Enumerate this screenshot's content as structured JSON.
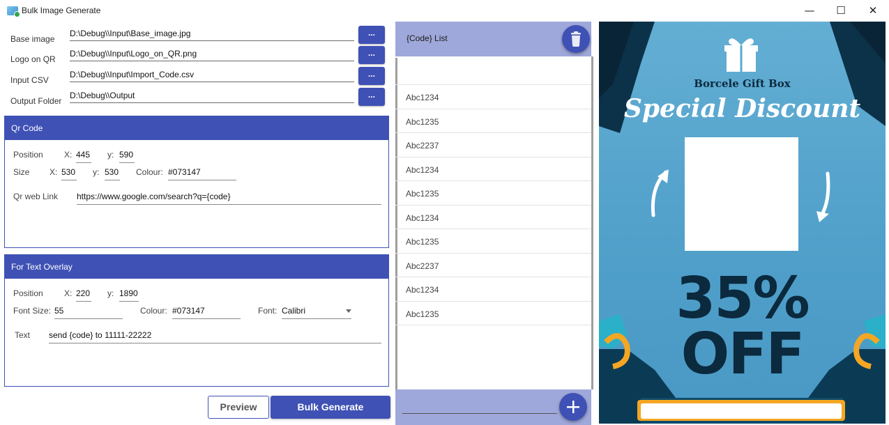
{
  "window": {
    "title": "Bulk Image Generate",
    "controls": {
      "minimize": "—",
      "maximize": "☐",
      "close": "✕"
    }
  },
  "files": [
    {
      "label": "Base image",
      "value": "D:\\Debug\\\\Input\\Base_image.jpg",
      "browse": "..."
    },
    {
      "label": "Logo on QR",
      "value": "D:\\Debug\\\\Input\\Logo_on_QR.png",
      "browse": "..."
    },
    {
      "label": "Input CSV",
      "value": "D:\\Debug\\\\Input\\Import_Code.csv",
      "browse": "..."
    },
    {
      "label": "Output Folder",
      "value": "D:\\Debug\\\\Output",
      "browse": "..."
    }
  ],
  "qr": {
    "header": "Qr Code",
    "position_label": "Position",
    "pos_x_label": "X:",
    "pos_x": "445",
    "pos_y_label": "y:",
    "pos_y": "590",
    "size_label": "Size",
    "size_x_label": "X:",
    "size_x": "530",
    "size_y_label": "y:",
    "size_y": "530",
    "colour_label": "Colour:",
    "colour": "#073147",
    "link_label": "Qr web Link",
    "link": "https://www.google.com/search?q={code}"
  },
  "overlay": {
    "header": "For Text Overlay",
    "position_label": "Position",
    "pos_x_label": "X:",
    "pos_x": "220",
    "pos_y_label": "y:",
    "pos_y": "1890",
    "font_size_label": "Font Size:",
    "font_size": "55",
    "colour_label": "Colour:",
    "colour": "#073147",
    "font_label": "Font:",
    "font": "Calibri",
    "text_label": "Text",
    "text": "send {code} to 11111-22222"
  },
  "actions": {
    "preview": "Preview",
    "bulk": "Bulk Generate"
  },
  "code_list": {
    "title": "{Code} List",
    "items": [
      "",
      "Abc1234",
      "Abc1235",
      "Abc2237",
      "Abc1234",
      "Abc1235",
      "Abc1234",
      "Abc1235",
      "Abc2237",
      "Abc1234",
      "Abc1235"
    ]
  },
  "preview_image": {
    "brand": "Borcele Gift Box",
    "headline": "Special Discount",
    "percent": "35%",
    "off": "OFF"
  },
  "colors": {
    "accent": "#3f51b5",
    "accent_light": "#9fa8da",
    "poster_bg": "#5aa8d0",
    "poster_dark": "#0b2a3e"
  }
}
